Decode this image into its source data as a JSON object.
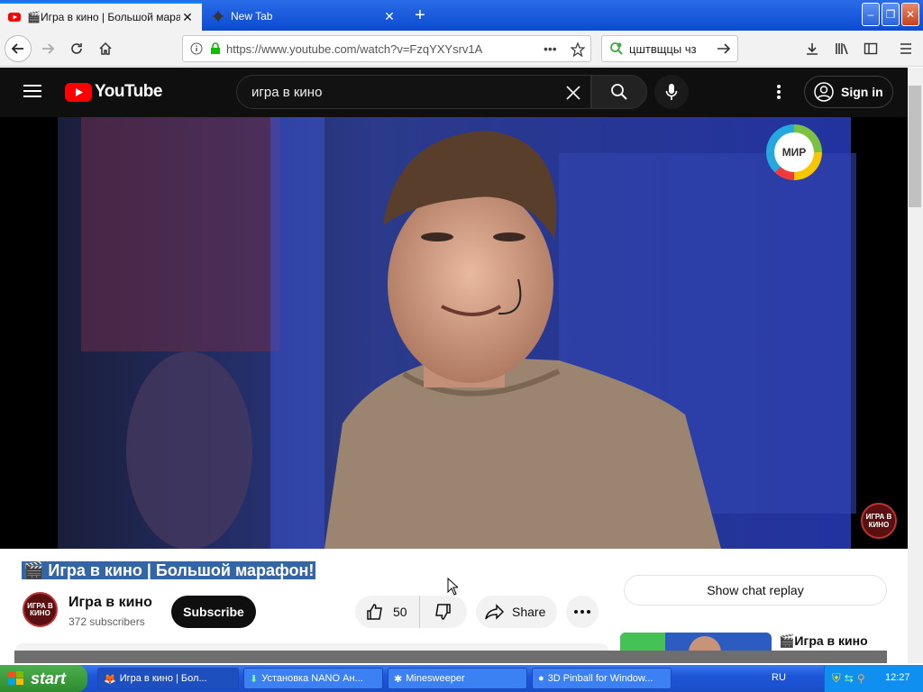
{
  "browser": {
    "tabs": [
      {
        "title": "🎬Игра в кино | Большой марафон!",
        "active": true
      },
      {
        "title": "New Tab",
        "active": false
      }
    ],
    "url": "https://www.youtube.com/watch?v=FzqYXYsrv1A",
    "search_text": "цштвщцы чз",
    "window_buttons": {
      "minimize": "–",
      "maximize": "❐",
      "close": "✕"
    }
  },
  "youtube": {
    "logo_text": "YouTube",
    "search_query": "игра в кино",
    "sign_in_label": "Sign in",
    "video": {
      "title": "🎬 Игра в кино | Большой марафон!",
      "channel_bug": "МИР",
      "corner_logo": "ИГРА В КИНО"
    },
    "channel": {
      "name": "Игра в кино",
      "subscribers": "372 subscribers",
      "avatar_text": "ИГРА В КИНО"
    },
    "subscribe_label": "Subscribe",
    "likes": "50",
    "share_label": "Share",
    "chat_replay_label": "Show chat replay",
    "recommended": {
      "title": "🎬Игра в кино"
    }
  },
  "taskbar": {
    "start_label": "start",
    "tasks": [
      {
        "label": "Игра в кино | Бол...",
        "active": true
      },
      {
        "label": "Установка NANO Ан...",
        "active": false
      },
      {
        "label": "Minesweeper",
        "active": false
      },
      {
        "label": "3D Pinball for Window...",
        "active": false
      }
    ],
    "language": "RU",
    "clock": "12:27"
  },
  "colors": {
    "youtube_red": "#ff0000",
    "selection": "#3465a4",
    "xp_blue": "#1e55d8",
    "start_green": "#2e8b2e"
  }
}
